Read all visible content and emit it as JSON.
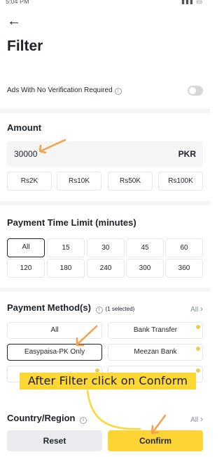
{
  "header": {
    "back_icon": "arrow-left-icon",
    "title": "Filter"
  },
  "no_verification": {
    "label": "Ads With No Verification Required",
    "toggle_on": false
  },
  "amount": {
    "title": "Amount",
    "value": "30000",
    "currency": "PKR",
    "presets": [
      "Rs2K",
      "Rs10K",
      "Rs50K",
      "Rs100K"
    ]
  },
  "payment_time": {
    "title": "Payment Time Limit (minutes)",
    "options": [
      "All",
      "15",
      "30",
      "45",
      "60",
      "120",
      "180",
      "240",
      "300",
      "360"
    ],
    "selected": "All"
  },
  "payment_methods": {
    "title": "Payment Method(s)",
    "selected_count": "(1 selected)",
    "all_label": "All",
    "options": [
      "All",
      "Bank Transfer",
      "Easypaisa-PK Only",
      "Meezan Bank"
    ],
    "selected": "Easypaisa-PK Only"
  },
  "country": {
    "title": "Country/Region",
    "all_label": "All"
  },
  "annotation": {
    "text": "After Filter click on Conform",
    "color": "#fdd835",
    "arrow_color": "#f5a04a"
  },
  "footer": {
    "reset_label": "Reset",
    "confirm_label": "Confirm"
  },
  "colors": {
    "accent": "#fcd535",
    "text": "#1e2329",
    "muted": "#848e9c"
  }
}
